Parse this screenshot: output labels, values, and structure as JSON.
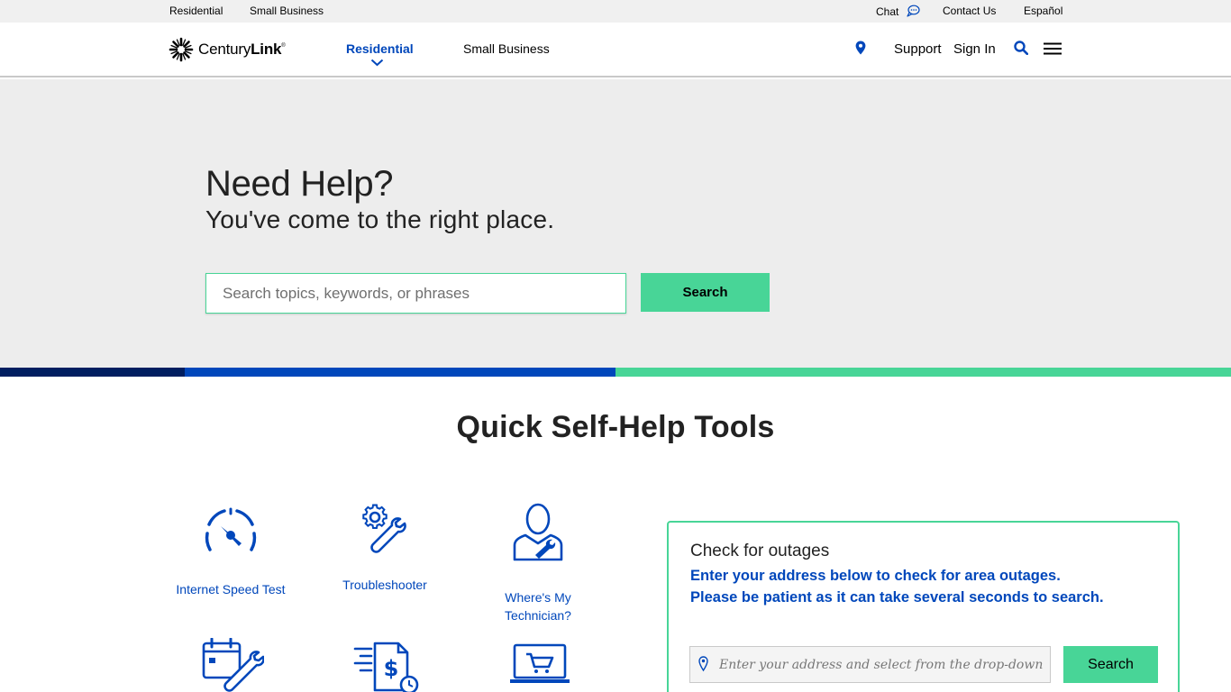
{
  "utility_bar": {
    "residential": "Residential",
    "small_business": "Small Business",
    "chat": "Chat",
    "contact_us": "Contact Us",
    "espanol": "Español"
  },
  "header": {
    "logo_text_regular": "Century",
    "logo_text_bold": "Link",
    "logo_mark": "®",
    "nav": {
      "residential": "Residential",
      "small_business": "Small Business"
    },
    "support": "Support",
    "sign_in": "Sign In"
  },
  "hero": {
    "title": "Need Help?",
    "subtitle": "You've come to the right place.",
    "search_placeholder": "Search topics, keywords, or phrases",
    "search_button": "Search"
  },
  "tools": {
    "title": "Quick Self-Help Tools",
    "items": [
      {
        "label": "Internet Speed Test",
        "icon": "speedometer-icon"
      },
      {
        "label": "Troubleshooter",
        "icon": "gear-wrench-icon"
      },
      {
        "label": "Where's My Technician?",
        "icon": "technician-icon"
      },
      {
        "label": "",
        "icon": "calendar-wrench-icon"
      },
      {
        "label": "",
        "icon": "bill-pay-icon"
      },
      {
        "label": "",
        "icon": "shopping-cart-laptop-icon"
      }
    ]
  },
  "outage": {
    "title": "Check for outages",
    "line1": "Enter your address below to check for area outages.",
    "line2": "Please be patient as it can take several seconds to search.",
    "input_placeholder": "Enter your address and select from the drop-down",
    "button": "Search"
  },
  "colors": {
    "brand_blue": "#0047bb",
    "brand_green": "#48d597",
    "navy": "#001e60",
    "hero_bg": "#ededed"
  }
}
